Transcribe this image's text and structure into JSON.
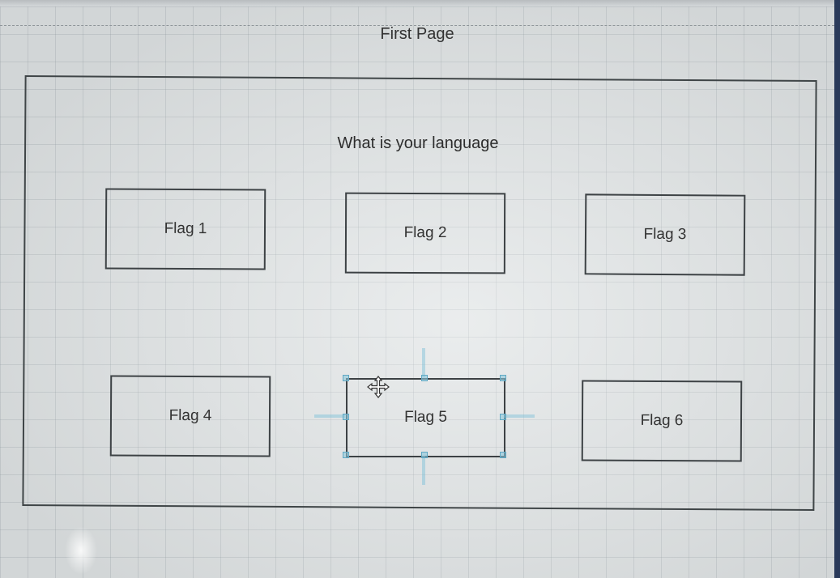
{
  "page": {
    "title": "First Page",
    "question": "What is your language"
  },
  "flags": [
    {
      "label": "Flag 1"
    },
    {
      "label": "Flag 2"
    },
    {
      "label": "Flag 3"
    },
    {
      "label": "Flag 4"
    },
    {
      "label": "Flag 5",
      "selected": true
    },
    {
      "label": "Flag 6"
    }
  ],
  "colors": {
    "selection": "#5fa8c4",
    "border": "#3d4245"
  },
  "icons": {
    "selected_cursor": "move-cursor-icon"
  }
}
